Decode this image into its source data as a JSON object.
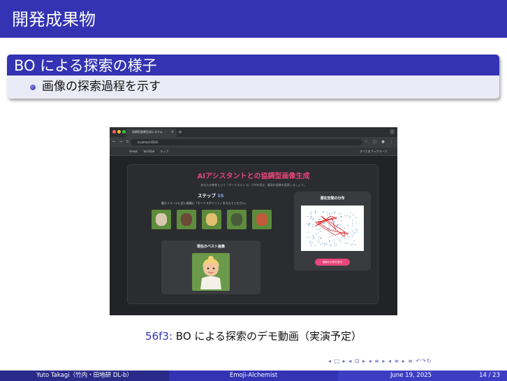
{
  "header": {
    "title": "開発成果物"
  },
  "block": {
    "title": "BO による探索の様子",
    "bullet": "画像の探索過程を示す"
  },
  "screenshot": {
    "tab_title": "協調型画像生成システム",
    "url": "localhost:8502",
    "bookmarks": [
      "すべてのブックマーク",
      "Gmail",
      "YouTube",
      "マップ"
    ],
    "app_title": "AIアシスタントとの協調型画像生成",
    "app_subtitle": "あなたの感性という「ボーナスエンコ」でAIを導き、最高の画像を探索しましょう。",
    "step_label": "ステップ",
    "step_number": "15",
    "step_instruction": "最もイメージに近い画像に「ボーナスポイント」を与えてください。",
    "best_label": "現在のベスト画像",
    "latent_label": "潜在空間の分布",
    "latent_button": "最新の分布を表示"
  },
  "caption": {
    "number": "56f3:",
    "text": "BO による探索のデモ動画（実演予定）"
  },
  "footer": {
    "author": "Yuto Takagi（竹内・田地研 DL-b）",
    "title": "Emoji-Alchemist",
    "date": "June 19, 2025",
    "page": "14 / 23"
  },
  "nav_symbols": "◂ □ ▸ ◂ ⊡ ▸ ◂ ≡ ▸ ◂ ≡ ▸   ≡   ↶↷↻",
  "colors": {
    "beamer_blue": "#3333b3",
    "block_body": "#ebebf7",
    "app_pink": "#e9467c"
  }
}
